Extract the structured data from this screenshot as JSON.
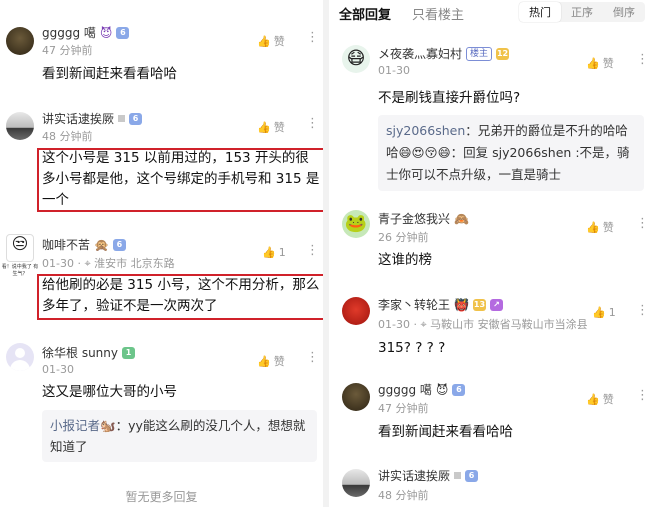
{
  "left": {
    "comments": [
      {
        "name": "ggggg 噶",
        "time": "47 分钟前",
        "text": "看到新闻赶来看看哈哈",
        "like": "赞"
      },
      {
        "name": "讲实话逮挨厥",
        "time": "48 分钟前",
        "text": "这个小号是 315 以前用过的，153 开头的很多小号都是他，这个号绑定的手机号和 315 是一个",
        "like": "赞"
      },
      {
        "name": "咖啡不苦",
        "date": "01-30",
        "location": "淮安市 北京东路",
        "text": "给他刷的必是 315 小号，这个不用分析，那么多年了，验证不是一次两次了",
        "like": "1",
        "avatar_caption": "看！说中我了 有生气？"
      },
      {
        "name": "徐华根 sunny",
        "date": "01-30",
        "text": "这又是哪位大哥的小号",
        "like": "赞",
        "reply": {
          "name": "小报记者",
          "text": "：yy能这么刷的没几个人，想想就知道了"
        }
      }
    ],
    "footer": "暂无更多回复"
  },
  "right": {
    "tabs": {
      "all": "全部回复",
      "host": "只看楼主"
    },
    "sort": {
      "hot": "热门",
      "asc": "正序",
      "desc": "倒序"
    },
    "comments": [
      {
        "name": "メ夜袭灬寡妇村",
        "badge": "楼主",
        "date": "01-30",
        "text": "不是刷钱直接升爵位吗?",
        "like": "赞",
        "reply": {
          "name": "sjy2066shen",
          "text": "：兄弟开的爵位是不升的哈哈哈😄😍😚😄：回复 sjy2066shen :不是，骑士你可以不点升级，一直是骑士"
        }
      },
      {
        "name": "青子金悠我兴",
        "time": "26 分钟前",
        "text": "这谁的榜",
        "like": "赞"
      },
      {
        "name": "李家丶转轮王",
        "date": "01-30",
        "location": "马鞍山市 安徽省马鞍山市当涂县",
        "text": "315? ? ? ?",
        "like": "1"
      },
      {
        "name": "ggggg 噶",
        "time": "47 分钟前",
        "text": "看到新闻赶来看看哈哈",
        "like": "赞"
      },
      {
        "name": "讲实话逮挨厥",
        "time": "48 分钟前"
      }
    ]
  },
  "colors": {
    "highlight_border": "#d0212a",
    "muted": "#9a9a9a",
    "reply_bg": "#f5f5f7"
  }
}
